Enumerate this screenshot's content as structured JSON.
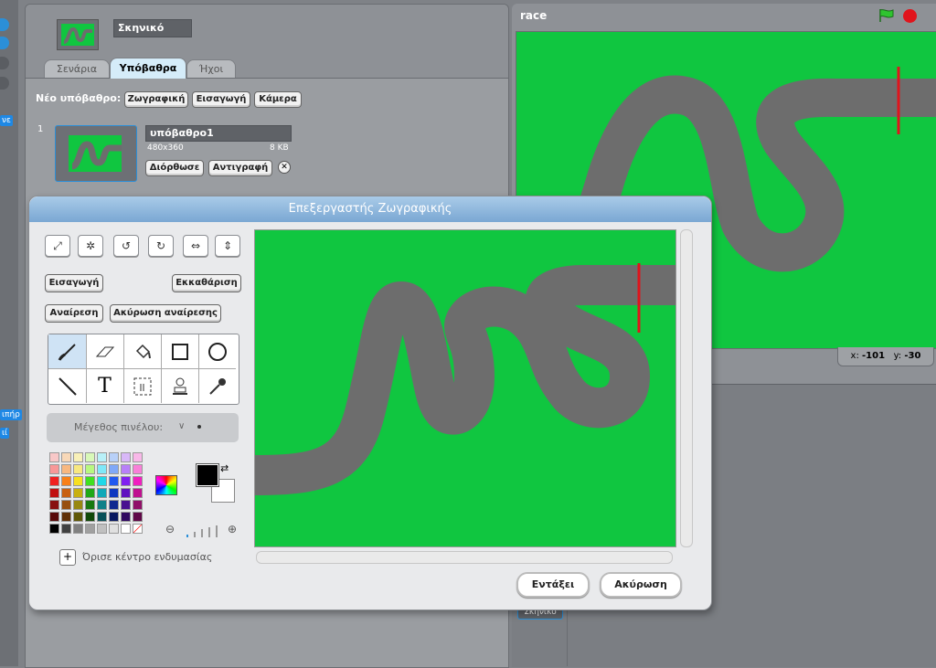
{
  "sprite_panel": {
    "sprite_name": "Σκηνικό",
    "tabs": [
      {
        "label": "Σενάρια",
        "active": false
      },
      {
        "label": "Υπόβαθρα",
        "active": true
      },
      {
        "label": "Ήχοι",
        "active": false
      }
    ]
  },
  "backgrounds": {
    "new_label": "Νέο υπόβαθρο:",
    "paint_button": "Ζωγραφική",
    "import_button": "Εισαγωγή",
    "camera_button": "Κάμερα",
    "item": {
      "number": "1",
      "name": "υπόβαθρο1",
      "dimensions": "480x360",
      "size": "8 KB",
      "edit_button": "Διόρθωσε",
      "copy_button": "Αντιγραφή"
    }
  },
  "stage": {
    "project_title": "race",
    "x_label": "x:",
    "x_value": "-101",
    "y_label": "y:",
    "y_value": "-30",
    "stage_thumb_label": "Σκηνικό"
  },
  "left_strip": {
    "tag1": "νε",
    "tag2": "ιπήρ",
    "tag3": "ιί"
  },
  "paint_editor": {
    "title": "Επεξεργαστής Ζωγραφικής",
    "import_button": "Εισαγωγή",
    "clear_button": "Εκκαθάριση",
    "undo_button": "Αναίρεση",
    "redo_button": "Ακύρωση αναίρεσης",
    "brush_size_label": "Μέγεθος πινέλου:",
    "set_center_label": "Όρισε κέντρο ενδυμασίας",
    "ok_button": "Εντάξει",
    "cancel_button": "Ακύρωση",
    "foreground_color": "#000000",
    "background_color": "#ffffff",
    "canvas_color": "#10c640",
    "track_color": "#6d6d6d",
    "finish_line_color": "#e0141c",
    "palette": [
      [
        "#f8c8c8",
        "#f8d8b8",
        "#f8f0b8",
        "#d8f8b8",
        "#b8f0f8",
        "#b8d0f8",
        "#d8b8f8",
        "#f8b8e8"
      ],
      [
        "#f89898",
        "#f8b880",
        "#f8e880",
        "#b8f880",
        "#80e8f8",
        "#80a8f8",
        "#b880f8",
        "#f880d8"
      ],
      [
        "#f02020",
        "#f88018",
        "#f8e020",
        "#40e020",
        "#20d8e8",
        "#2058f0",
        "#8020f0",
        "#f020c0"
      ],
      [
        "#c01010",
        "#c86010",
        "#c8b010",
        "#20a818",
        "#10a8b8",
        "#1038c0",
        "#6010c0",
        "#c01090"
      ],
      [
        "#881010",
        "#985010",
        "#988810",
        "#187810",
        "#108088",
        "#102890",
        "#481090",
        "#901068"
      ],
      [
        "#580808",
        "#603008",
        "#605808",
        "#104808",
        "#085058",
        "#081860",
        "#300860",
        "#600848"
      ],
      [
        "#000000",
        "#404040",
        "#808080",
        "#a0a0a0",
        "#c0c0c0",
        "#e0e0e0",
        "#ffffff",
        "transparent"
      ]
    ]
  }
}
